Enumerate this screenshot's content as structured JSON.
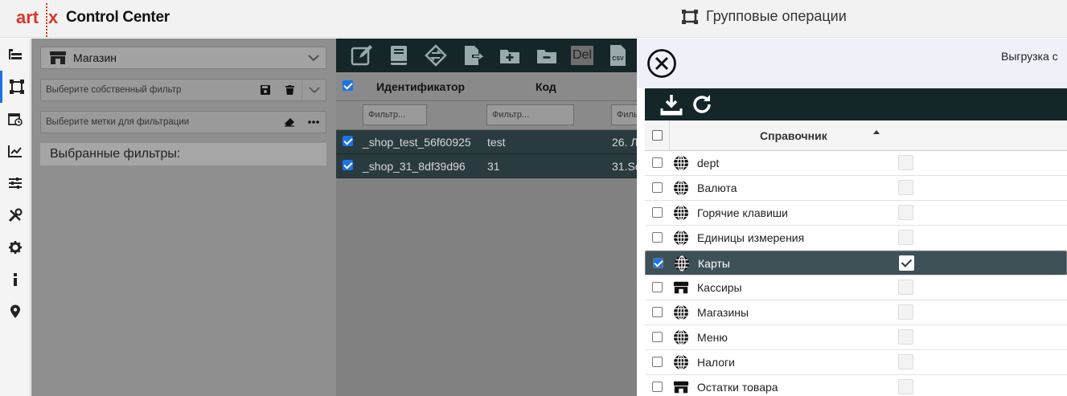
{
  "app": {
    "logo_text": "artix",
    "title": "Control Center"
  },
  "page": {
    "title": "Групповые операции"
  },
  "filters": {
    "entity_select": "Магазин",
    "own_filter_placeholder": "Выберите собственный фильтр",
    "tags_placeholder": "Выберите метки для фильтрации",
    "selected_filters_label": "Выбранные фильтры:"
  },
  "grid": {
    "columns": [
      "Идентификатор",
      "Код"
    ],
    "filter_placeholders": [
      "Фильтр...",
      "Фильтр...",
      "Филь"
    ],
    "del_label": "Del",
    "csv_label": "CSV",
    "rows": [
      {
        "id": "_shop_test_56f60925",
        "code": "test",
        "name": "26. Л",
        "checked": true
      },
      {
        "id": "_shop_31_8df39d96",
        "code": "31",
        "name": "31.Sc",
        "checked": true
      }
    ]
  },
  "dialog": {
    "title": "Выгрузка с",
    "column_header": "Справочник",
    "rows": [
      {
        "name": "dept",
        "icon": "globe-icon",
        "checked": false,
        "flag": false
      },
      {
        "name": "Валюта",
        "icon": "globe-icon",
        "checked": false,
        "flag": false
      },
      {
        "name": "Горячие клавиши",
        "icon": "globe-icon",
        "checked": false,
        "flag": false
      },
      {
        "name": "Единицы измерения",
        "icon": "globe-icon",
        "checked": false,
        "flag": false
      },
      {
        "name": "Карты",
        "icon": "globe-icon",
        "checked": true,
        "flag": true
      },
      {
        "name": "Кассиры",
        "icon": "store-icon",
        "checked": false,
        "flag": false
      },
      {
        "name": "Магазины",
        "icon": "globe-icon",
        "checked": false,
        "flag": false
      },
      {
        "name": "Меню",
        "icon": "globe-icon",
        "checked": false,
        "flag": false
      },
      {
        "name": "Налоги",
        "icon": "globe-icon",
        "checked": false,
        "flag": false
      },
      {
        "name": "Остатки товара",
        "icon": "store-icon",
        "checked": false,
        "flag": false
      }
    ]
  },
  "colors": {
    "brand": "#d9352b",
    "dark_toolbar": "#142627",
    "selected_row": "#3d5157",
    "accent": "#1a73e8"
  }
}
